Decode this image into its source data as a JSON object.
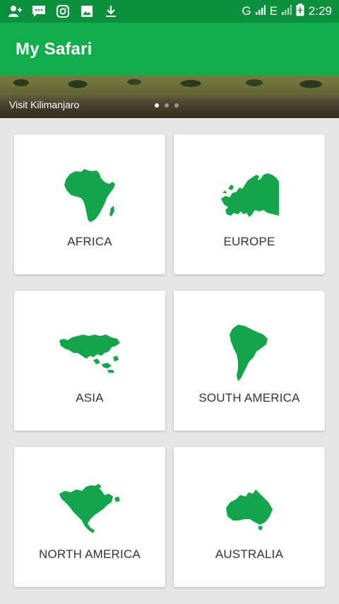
{
  "status_bar": {
    "icons": [
      "add-contact-icon",
      "chat-icon",
      "instagram-icon",
      "image-icon",
      "download-icon"
    ],
    "network_g": "G",
    "network_e": "E",
    "time": "2:29"
  },
  "app_bar": {
    "title": "My Safari"
  },
  "banner": {
    "caption": "Visit Kilimanjaro",
    "page_count": 3,
    "active_index": 0
  },
  "continents": [
    {
      "label": "AFRICA",
      "icon": "africa-map-icon"
    },
    {
      "label": "EUROPE",
      "icon": "europe-map-icon"
    },
    {
      "label": "ASIA",
      "icon": "asia-map-icon"
    },
    {
      "label": "SOUTH AMERICA",
      "icon": "south-america-map-icon"
    },
    {
      "label": "NORTH AMERICA",
      "icon": "north-america-map-icon"
    },
    {
      "label": "AUSTRALIA",
      "icon": "australia-map-icon"
    }
  ],
  "colors": {
    "status_bar": "#0a8f3c",
    "app_bar": "#12ad4b",
    "map_green": "#12a54a",
    "background": "#e8e5e5"
  }
}
